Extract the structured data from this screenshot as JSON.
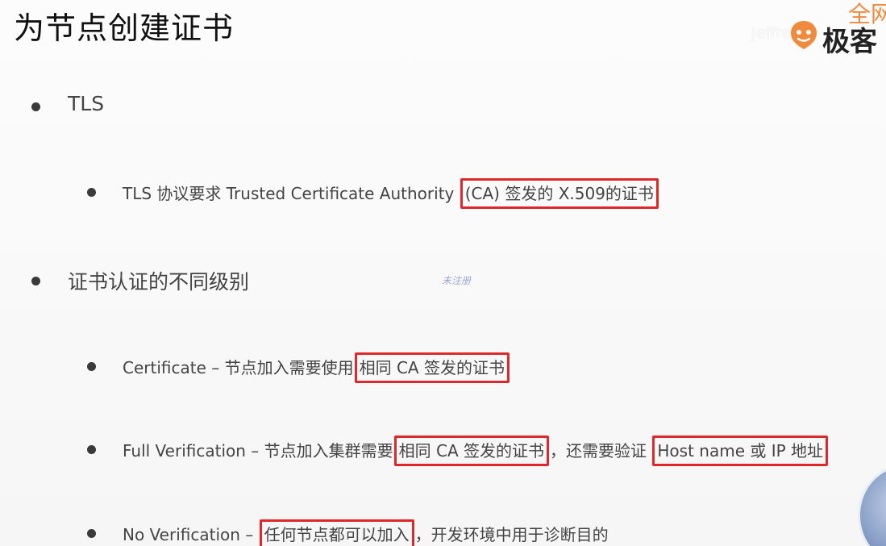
{
  "title": "为节点创建证书",
  "watermark": "Jeffrey",
  "logo": {
    "top_text": "全网",
    "text": "极客",
    "accent_color": "#f08a3c"
  },
  "stamp": "未注册",
  "highlight_color": "#e0282c",
  "items": {
    "tls": {
      "label": "TLS",
      "sub": {
        "prefix": "TLS 协议要求 Trusted Certificate Authority ",
        "highlight": "(CA) 签发的 X.509的证书"
      }
    },
    "levels": {
      "label": "证书认证的不同级别",
      "certificate": {
        "prefix": "Certificate – 节点加入需要使用",
        "highlight": "相同 CA 签发的证书"
      },
      "full": {
        "prefix": "Full Verification – 节点加入集群需要",
        "highlight1": "相同 CA 签发的证书",
        "middle": "，还需要验证 ",
        "highlight2": "Host name 或 IP 地址"
      },
      "none": {
        "prefix": "No Verification – ",
        "highlight": "任何节点都可以加入",
        "suffix": "，开发环境中用于诊断目的"
      }
    }
  }
}
